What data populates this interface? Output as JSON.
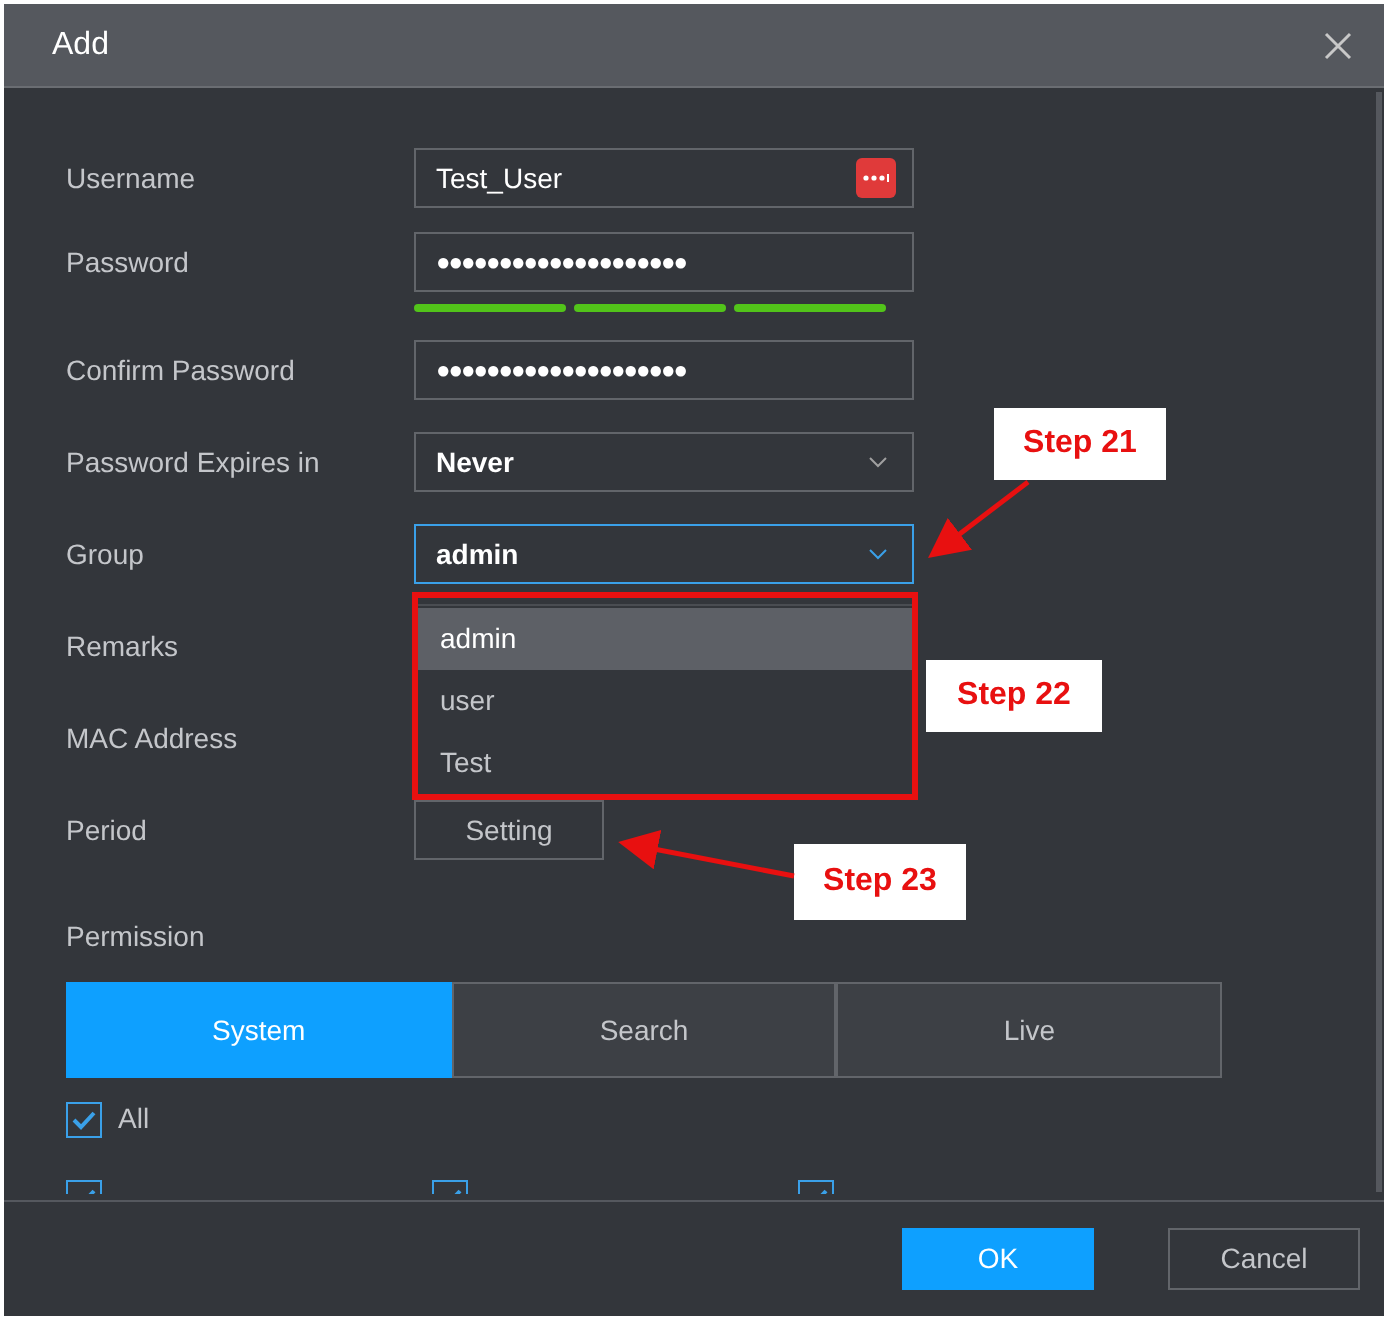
{
  "window": {
    "title": "Add"
  },
  "fields": [
    {
      "kind": "text",
      "label": "Username",
      "value": "Test_User"
    },
    {
      "kind": "password",
      "label": "Password",
      "value": "●●●●●●●●●●●●●●●●●●●●",
      "strength": [
        true,
        true,
        true
      ]
    },
    {
      "kind": "password",
      "label": "Confirm Password",
      "value": "●●●●●●●●●●●●●●●●●●●●"
    },
    {
      "kind": "select",
      "label": "Password Expires in",
      "value": "Never",
      "focused": false
    },
    {
      "kind": "select",
      "label": "Group",
      "value": "admin",
      "focused": true
    },
    {
      "kind": "hidden",
      "label": "Remarks"
    },
    {
      "kind": "hidden",
      "label": "MAC Address"
    },
    {
      "kind": "button",
      "label": "Period",
      "value": "Setting"
    }
  ],
  "group_dropdown": {
    "options": [
      {
        "label": "admin",
        "selected": true
      },
      {
        "label": "user",
        "selected": false
      },
      {
        "label": "Test",
        "selected": false
      }
    ]
  },
  "permission": {
    "label": "Permission",
    "tabs": [
      {
        "label": "System",
        "selected": true
      },
      {
        "label": "Search",
        "selected": false
      },
      {
        "label": "Live",
        "selected": false
      }
    ],
    "all": {
      "label": "All",
      "checked": true
    },
    "items": [
      {
        "checked": true
      },
      {
        "checked": true
      },
      {
        "checked": true
      }
    ]
  },
  "buttons": [
    {
      "label": "OK",
      "kind": "primary"
    },
    {
      "label": "Cancel",
      "kind": "secondary"
    }
  ],
  "annotations": [
    {
      "label": "Step 21"
    },
    {
      "label": "Step 22"
    },
    {
      "label": "Step 23"
    }
  ]
}
